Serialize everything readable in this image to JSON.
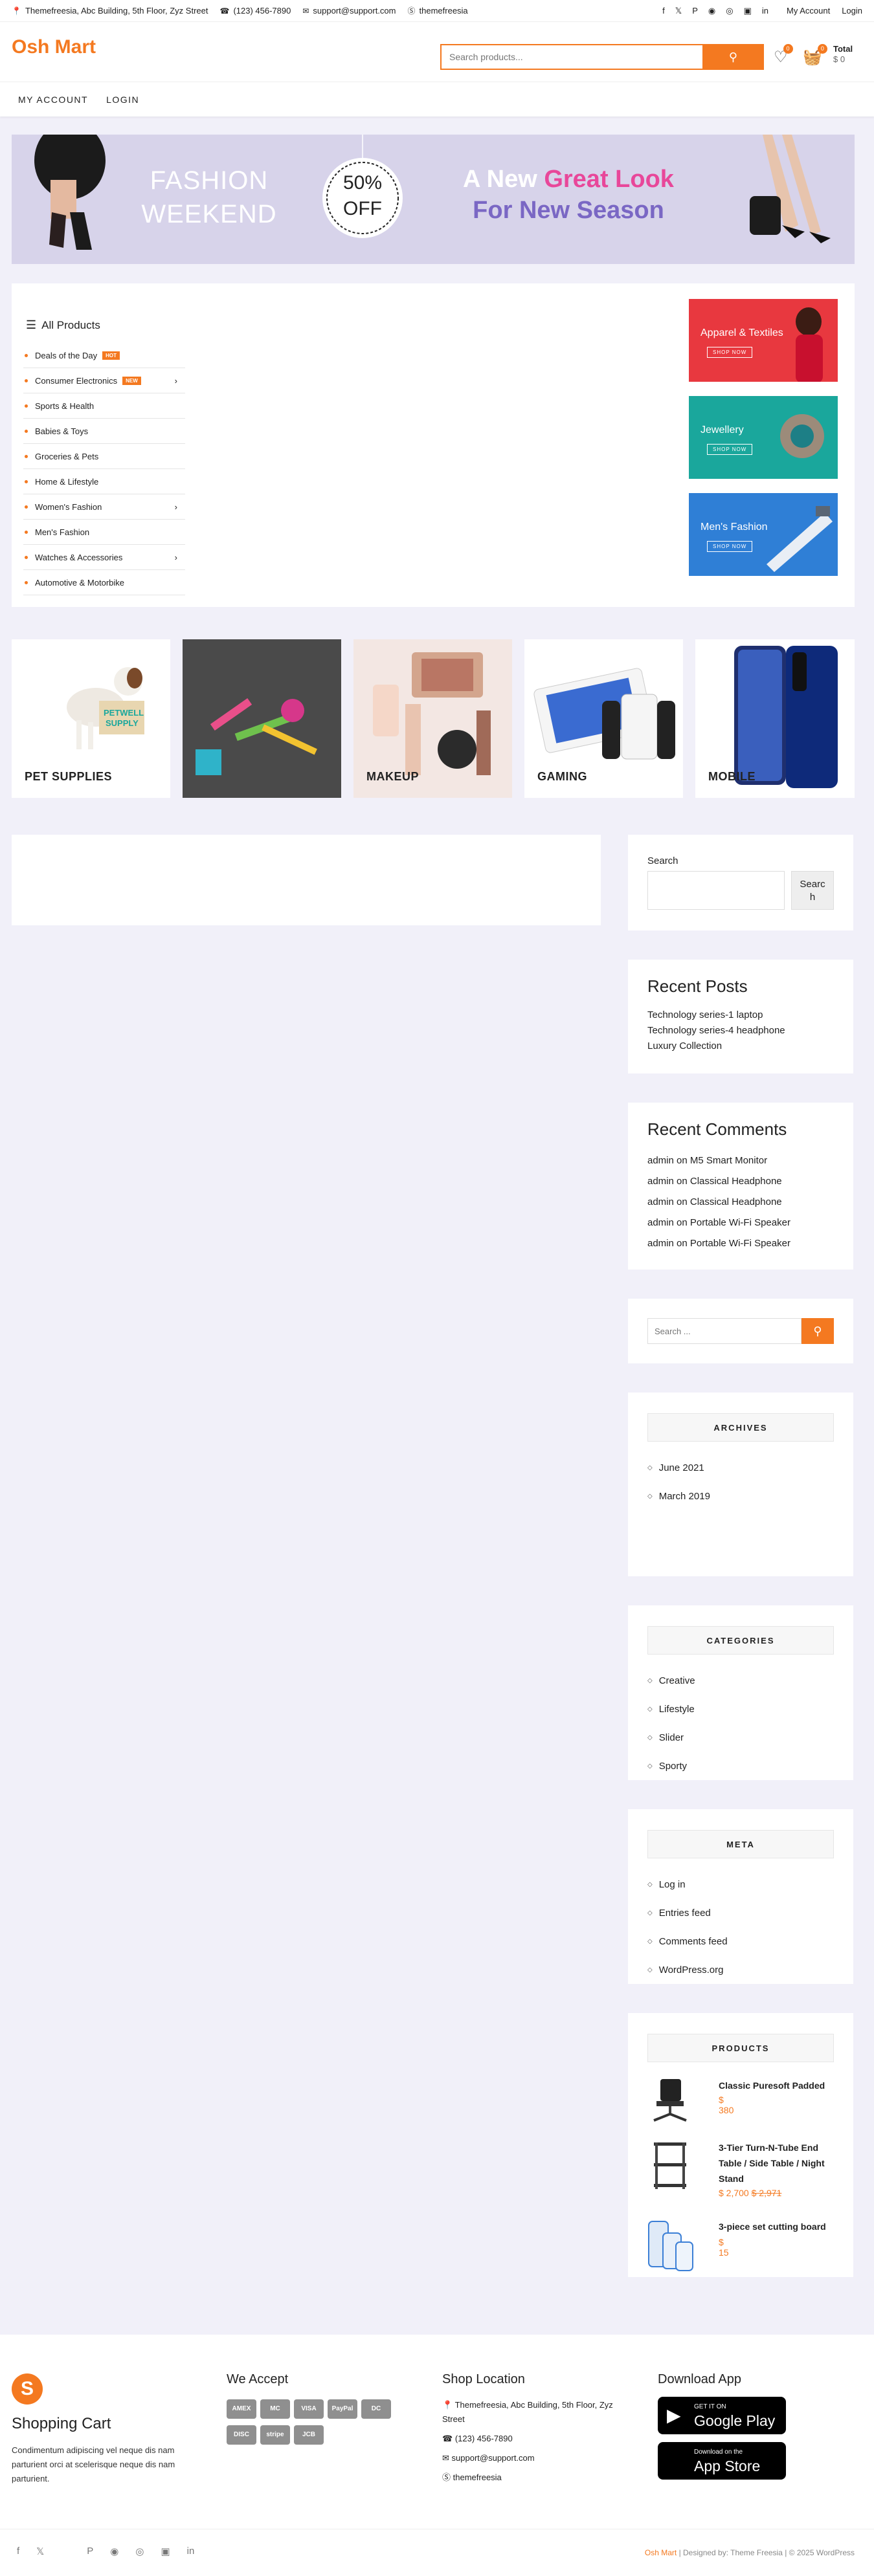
{
  "topbar": {
    "address": "Themefreesia, Abc Building, 5th Floor, Zyz Street",
    "phone": "(123) 456-7890",
    "email": "support@support.com",
    "skype": "themefreesia",
    "social": [
      "f",
      "𝕏",
      "P",
      "◉",
      "◎",
      "▣",
      "in"
    ],
    "my_account": "My Account",
    "login": "Login"
  },
  "header": {
    "logo": "Osh Mart",
    "search_placeholder": "Search products...",
    "wishlist_count": "0",
    "cart_count": "0",
    "total_label": "Total",
    "total_value": "$ 0"
  },
  "nav": [
    "MY ACCOUNT",
    "LOGIN"
  ],
  "banner": {
    "line1": "FASHION",
    "line2": "WEEKEND",
    "circle1": "50%",
    "circle2": "OFF",
    "tag_a": "A New ",
    "tag_b": "Great Look",
    "tag_c": "For New Season"
  },
  "categories": {
    "title": "All Products",
    "items": [
      {
        "label": "Deals of the Day",
        "tag": "HOT",
        "arrow": ""
      },
      {
        "label": "Consumer Electronics",
        "tag": "NEW",
        "arrow": "›"
      },
      {
        "label": "Sports & Health",
        "tag": "",
        "arrow": ""
      },
      {
        "label": "Babies & Toys",
        "tag": "",
        "arrow": ""
      },
      {
        "label": "Groceries & Pets",
        "tag": "",
        "arrow": ""
      },
      {
        "label": "Home & Lifestyle",
        "tag": "",
        "arrow": ""
      },
      {
        "label": "Women's Fashion",
        "tag": "",
        "arrow": "›"
      },
      {
        "label": "Men's Fashion",
        "tag": "",
        "arrow": ""
      },
      {
        "label": "Watches & Accessories",
        "tag": "",
        "arrow": "›"
      },
      {
        "label": "Automotive & Motorbike",
        "tag": "",
        "arrow": ""
      }
    ]
  },
  "promos": [
    {
      "title": "Apparel & Textiles",
      "button": "SHOP NOW",
      "color": "#e8383f"
    },
    {
      "title": "Jewellery",
      "button": "SHOP NOW",
      "color": "#1aa79c"
    },
    {
      "title": "Men's Fashion",
      "button": "SHOP NOW",
      "color": "#2f7fd6"
    }
  ],
  "tiles": [
    "PET SUPPLIES",
    "",
    "MAKEUP",
    "GAMING",
    "MOBILE"
  ],
  "sidebar": {
    "search_label": "Search",
    "search_button": "Search",
    "recent_posts_title": "Recent Posts",
    "recent_posts": [
      "Technology series-1 laptop",
      "Technology series-4 headphone",
      "Luxury Collection"
    ],
    "recent_comments_title": "Recent Comments",
    "recent_comments": [
      {
        "author": "admin",
        "on": " on ",
        "post": "M5 Smart Monitor"
      },
      {
        "author": "admin",
        "on": " on ",
        "post": "Classical Headphone"
      },
      {
        "author": "admin",
        "on": " on ",
        "post": "Classical Headphone"
      },
      {
        "author": "admin",
        "on": " on ",
        "post": "Portable Wi-Fi Speaker"
      },
      {
        "author": "admin",
        "on": " on ",
        "post": "Portable Wi-Fi Speaker"
      }
    ],
    "search2_placeholder": "Search ...",
    "archives_title": "ARCHIVES",
    "archives": [
      "June 2021",
      "March 2019"
    ],
    "categories_title": "CATEGORIES",
    "categories": [
      "Creative",
      "Lifestyle",
      "Slider",
      "Sporty"
    ],
    "meta_title": "META",
    "meta": [
      "Log in",
      "Entries feed",
      "Comments feed",
      "WordPress.org"
    ],
    "products_title": "PRODUCTS",
    "products": [
      {
        "name": "Classic Puresoft Padded",
        "price": "$ 380",
        "old": ""
      },
      {
        "name": "3-Tier Turn-N-Tube End Table / Side Table / Night Stand",
        "price": "$ 2,700",
        "old": "$ 2,971"
      },
      {
        "name": "3-piece set cutting board",
        "price": "$ 15",
        "old": ""
      }
    ]
  },
  "footer": {
    "brand_title": "Shopping Cart",
    "brand_text": "Condimentum adipiscing vel neque dis nam parturient orci at scelerisque neque dis nam parturient.",
    "accept_title": "We Accept",
    "pay_methods": [
      "AMEX",
      "MC",
      "VISA",
      "PayPal",
      "DC",
      "DISC",
      "stripe",
      "JCB"
    ],
    "location_title": "Shop Location",
    "address": "Themefreesia, Abc Building, 5th Floor, Zyz Street",
    "phone": "(123) 456-7890",
    "email": "support@support.com",
    "skype": "themefreesia",
    "app_title": "Download App",
    "google_small": "GET IT ON",
    "google_big": "Google Play",
    "apple_small": "Download on the",
    "apple_big": "App Store",
    "copy_site": "Osh Mart",
    "copy_rest": " | Designed by: Theme Freesia | © 2025 WordPress",
    "social": [
      "f",
      "𝕏",
      "P",
      "◉",
      "◎",
      "▣",
      "in"
    ]
  },
  "colors": {
    "accent": "#f47920",
    "pink": "#e8479a",
    "purple": "#7a67c4"
  }
}
